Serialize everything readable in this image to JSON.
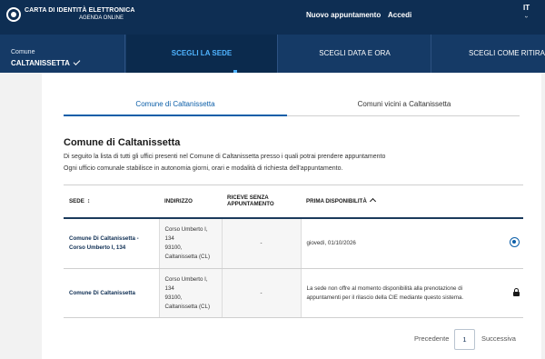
{
  "header": {
    "logo_title": "CARTA DI IDENTITÀ ELETTRONICA",
    "logo_subtitle": "AGENDA ONLINE",
    "new_appointment": "Nuovo appuntamento",
    "login": "Accedi",
    "language": "IT"
  },
  "steps": [
    {
      "label": "Comune",
      "value": "CALTANISSETTA"
    },
    {
      "label": "SCEGLI LA SEDE"
    },
    {
      "label": "SCEGLI DATA E ORA"
    },
    {
      "label": "SCEGLI COME RITIRARE"
    }
  ],
  "tabs": [
    "Comune di Caltanissetta",
    "Comuni vicini a Caltanissetta"
  ],
  "section": {
    "title": "Comune di Caltanissetta",
    "desc1": "Di seguito la lista di tutti gli uffici presenti nel Comune di Caltanissetta presso i quali potrai prendere appuntamento",
    "desc2": "Ogni ufficio comunale stabilisce in autonomia giorni, orari e modalità di richiesta dell'appuntamento."
  },
  "table": {
    "headers": {
      "sede": "SEDE",
      "indirizzo": "INDIRIZZO",
      "riceve_1": "RICEVE SENZA",
      "riceve_2": "APPUNTAMENTO",
      "prima": "PRIMA DISPONIBILITÀ"
    },
    "rows": [
      {
        "sede_1": "Comune Di Caltanissetta -",
        "sede_2": "Corso Umberto I, 134",
        "addr_1": "Corso Umberto I,",
        "addr_2": "134",
        "addr_3": "93100,",
        "addr_4": "Caltanissetta (CL)",
        "riceve": "-",
        "prima": "giovedì, 01/10/2026",
        "action_icon": "radio-selected"
      },
      {
        "sede_1": "Comune Di Caltanissetta",
        "addr_1": "Corso Umberto I,",
        "addr_2": "134",
        "addr_3": "93100,",
        "addr_4": "Caltanissetta (CL)",
        "riceve": "-",
        "prima_1": "La sede non offre al momento disponibilità alla prenotazione di",
        "prima_2": "appuntamenti per il rilascio della CIE mediante questo sistema.",
        "action_icon": "lock"
      }
    ]
  },
  "pagination": {
    "prev": "Precedente",
    "page": "1",
    "next": "Successiva"
  },
  "colors": {
    "topbar": "#0e2e53",
    "stepbar": "#153a66",
    "accent": "#0b5ea8",
    "active_step_text": "#4fb3ff"
  }
}
